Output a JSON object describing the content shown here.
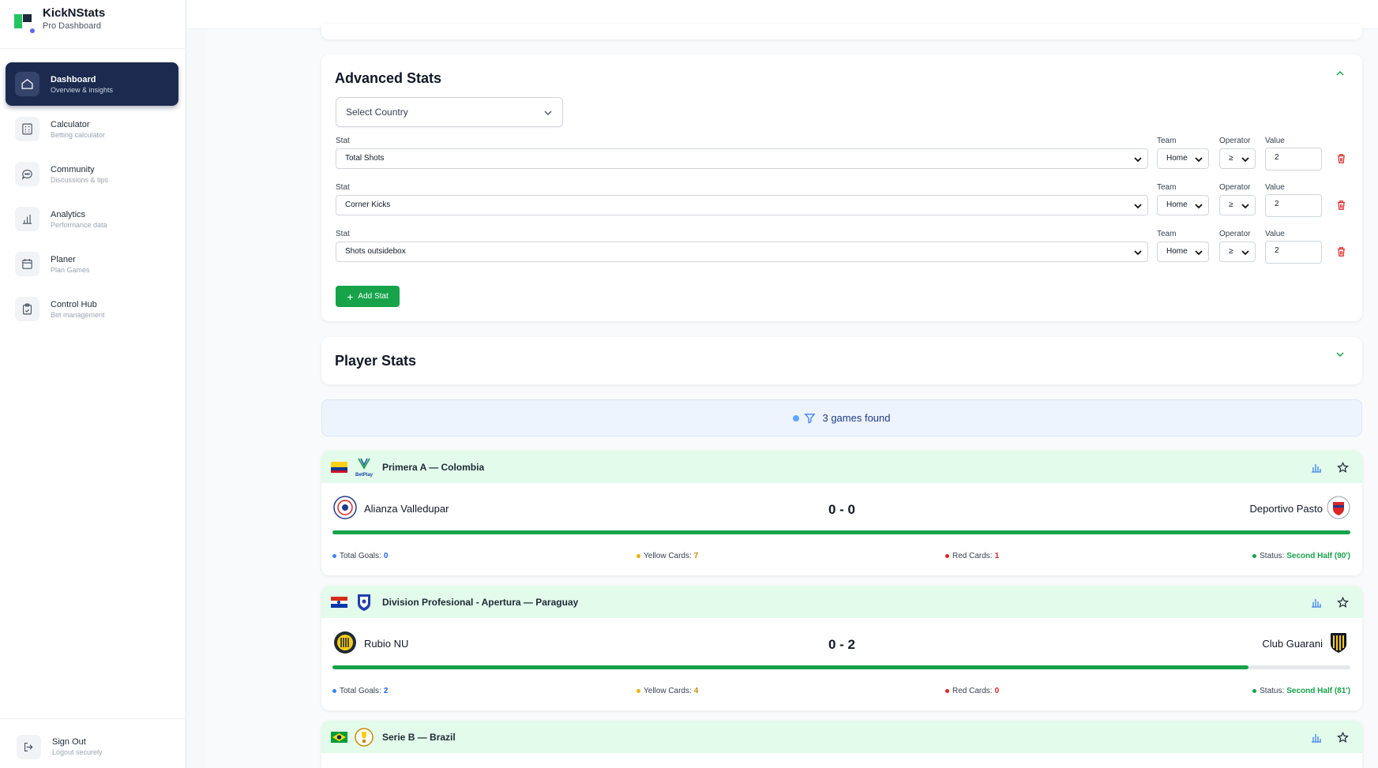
{
  "brand": {
    "title": "KickNStats",
    "subtitle": "Pro Dashboard"
  },
  "nav": [
    {
      "label": "Dashboard",
      "sub": "Overview & insights",
      "icon": "home-icon"
    },
    {
      "label": "Calculator",
      "sub": "Betting calculator",
      "icon": "calculator-icon"
    },
    {
      "label": "Community",
      "sub": "Discussions & tips",
      "icon": "chat-icon"
    },
    {
      "label": "Analytics",
      "sub": "Performance data",
      "icon": "bar-chart-icon"
    },
    {
      "label": "Planer",
      "sub": "Plan Games",
      "icon": "calendar-icon"
    },
    {
      "label": "Control Hub",
      "sub": "Bet management",
      "icon": "clipboard-icon"
    }
  ],
  "signout": {
    "label": "Sign Out",
    "sub": "Logout securely"
  },
  "advanced": {
    "title": "Advanced Stats",
    "country_placeholder": "Select Country",
    "labels": {
      "stat": "Stat",
      "team": "Team",
      "operator": "Operator",
      "value": "Value"
    },
    "rows": [
      {
        "stat": "Total Shots",
        "team": "Home",
        "operator": "≥",
        "value": "2"
      },
      {
        "stat": "Corner Kicks",
        "team": "Home",
        "operator": "≥",
        "value": "2"
      },
      {
        "stat": "Shots outsidebox",
        "team": "Home",
        "operator": "≥",
        "value": "2"
      }
    ],
    "add_button": "Add Stat"
  },
  "player_stats": {
    "title": "Player Stats"
  },
  "found": {
    "text": "3 games found"
  },
  "footer_labels": {
    "goals": "Total Goals:",
    "yellow": "Yellow Cards:",
    "red": "Red Cards:",
    "status": "Status:"
  },
  "games": [
    {
      "league": "Primera A — Colombia",
      "flag": "colombia",
      "home": "Alianza Valledupar",
      "away": "Deportivo Pasto",
      "score": "0 - 0",
      "progress": 1.0,
      "goals": "0",
      "yellow": "7",
      "red": "1",
      "status": "Second Half (90')"
    },
    {
      "league": "Division Profesional - Apertura — Paraguay",
      "flag": "paraguay",
      "home": "Rubio NU",
      "away": "Club Guarani",
      "score": "0 - 2",
      "progress": 0.9,
      "goals": "2",
      "yellow": "4",
      "red": "0",
      "status": "Second Half (81')"
    },
    {
      "league": "Serie B — Brazil",
      "flag": "brazil"
    }
  ],
  "colors": {
    "accent": "#16a34a",
    "nav_active": "#1b2a4e",
    "blue": "#2563eb",
    "yellow": "#eab308",
    "red": "#dc2626"
  }
}
